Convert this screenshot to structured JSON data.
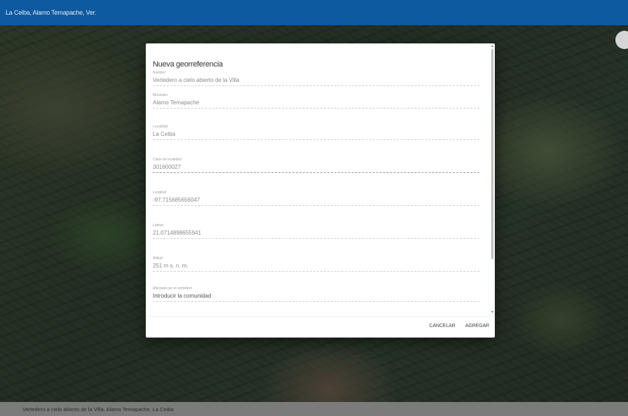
{
  "header": {
    "title": "La Ceiba, Alamo Temapache, Ver."
  },
  "dialog": {
    "title": "Nueva georreferencia",
    "fields": [
      {
        "label": "Nombre",
        "value": "Vertedero a cielo abierto de la Villa",
        "spacing": "tight"
      },
      {
        "label": "Municipio",
        "value": "Alamo Temapache",
        "spacing": "tight"
      },
      {
        "label": "Localidad",
        "value": "La Ceiba",
        "spacing": "loose"
      },
      {
        "label": "Clave de localidad",
        "value": "301600027",
        "spacing": "loose"
      },
      {
        "label": "Longitud",
        "value": "-97.715685656047",
        "spacing": "loose"
      },
      {
        "label": "Latitud",
        "value": "21.0714898655941",
        "spacing": "loose"
      },
      {
        "label": "Altitud",
        "value": "251 m s. n. m.",
        "spacing": "loose"
      },
      {
        "label": "Afectado por el vertedero",
        "value": "Introducir la comunidad",
        "spacing": "loose"
      }
    ],
    "cancel_label": "CANCELAR",
    "add_label": "AGREGAR"
  },
  "footer": {
    "text": "Vertedero a cielo abierto de la Villa, Alamo Temapache, La Ceiba"
  }
}
